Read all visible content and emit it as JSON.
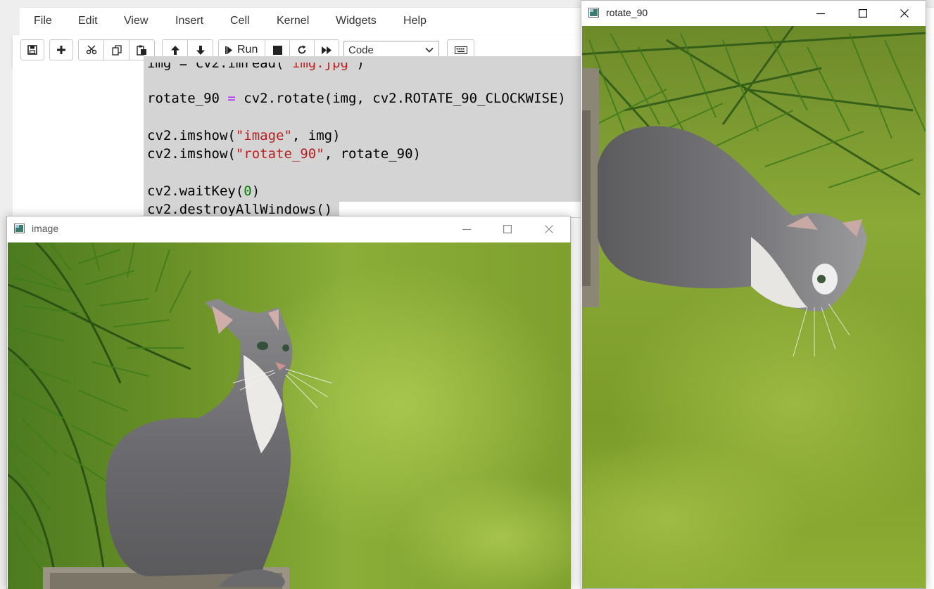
{
  "menu": [
    "File",
    "Edit",
    "View",
    "Insert",
    "Cell",
    "Kernel",
    "Widgets",
    "Help"
  ],
  "toolbar": {
    "run_label": "Run",
    "cell_type": "Code"
  },
  "code": {
    "line0_a": "img = cv2.imread(",
    "line0_s": "'img.jpg'",
    "line0_b": ")",
    "line1_a": "rotate_90 ",
    "line1_op": "=",
    "line1_b": " cv2.rotate(img, cv2.ROTATE_90_CLOCKWISE)",
    "line2_a": "cv2.imshow(",
    "line2_s": "\"image\"",
    "line2_b": ", img)",
    "line3_a": "cv2.imshow(",
    "line3_s": "\"rotate_90\"",
    "line3_b": ", rotate_90)",
    "line4_a": "cv2.waitKey(",
    "line4_n": "0",
    "line4_b": ")",
    "line5": "cv2.destroyAllWindows()"
  },
  "windows": {
    "image": {
      "title": "image"
    },
    "rotate": {
      "title": "rotate_90"
    }
  },
  "colors": {
    "string": "#ba2121",
    "number": "#008000",
    "operator": "#aa22ff",
    "selection": "#d4d4d4"
  }
}
